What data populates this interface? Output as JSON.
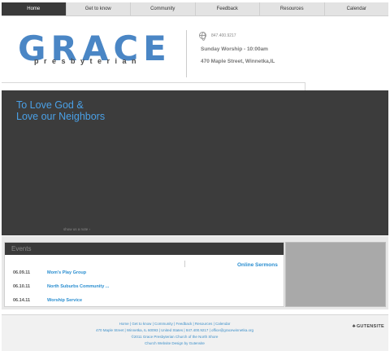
{
  "nav": {
    "items": [
      {
        "label": "Home",
        "active": true
      },
      {
        "label": "Get to know",
        "active": false
      },
      {
        "label": "Community",
        "active": false
      },
      {
        "label": "Feedback",
        "active": false
      },
      {
        "label": "Resources",
        "active": false
      },
      {
        "label": "Calendar",
        "active": false
      }
    ]
  },
  "header": {
    "logo_word": "GRACE",
    "logo_sub": "presbyterian",
    "phone": "847.400.9217",
    "worship": "Sunday Worship - 10:00am",
    "address": "470 Maple Street, Winnetka,IL"
  },
  "hero": {
    "title": "To Love God & Love our Neighbors",
    "link": "show us a note ›"
  },
  "events": {
    "heading": "Events",
    "online_sermons": "Online Sermons",
    "items": [
      {
        "date": "06.09.11",
        "name": "Mom's Play Group"
      },
      {
        "date": "06.10.11",
        "name": "North Suburbs Community ..."
      },
      {
        "date": "06.14.11",
        "name": "Worship Service"
      }
    ]
  },
  "footer": {
    "links": "Home | Get to know | Community | Feedback | Resources | Calendar",
    "address": "470 Maple Street | Winnetka, IL 60093 | United States | 847.400.9217 | office@gracewinnetka.org",
    "copyright": "©2011 Grace Presbyterian Church of the North Shore",
    "credit": "Church Website Design by Gutensite",
    "brand": "GUTENSITE"
  },
  "colors": {
    "accent": "#4a86c5",
    "link": "#2a8ed0",
    "nav_active": "#3a3a3a",
    "hero_bg": "#3c3c3c"
  }
}
